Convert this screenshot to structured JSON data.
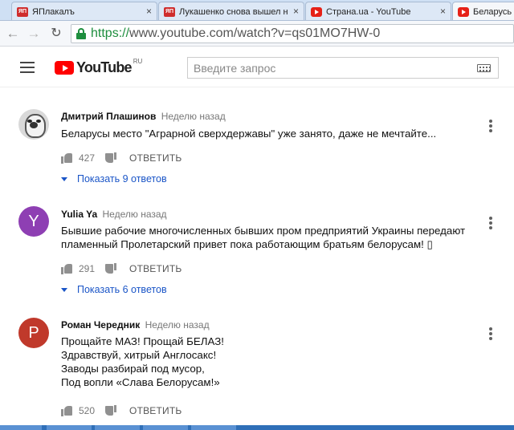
{
  "browser": {
    "tabs": [
      {
        "label": "ЯПлакалъ",
        "favicon": "yaplakal-favicon",
        "active": false
      },
      {
        "label": "Лукашенко снова вышел н",
        "favicon": "yaplakal-favicon",
        "active": false
      },
      {
        "label": "Страна.ua - YouTube",
        "favicon": "youtube-favicon",
        "active": false
      },
      {
        "label": "Беларусь в",
        "favicon": "youtube-favicon",
        "active": true
      }
    ],
    "close_glyph": "×",
    "url_scheme": "https://",
    "url_rest": "www.youtube.com/watch?v=qs01MO7HW-0"
  },
  "youtube": {
    "logo_text": "YouTube",
    "region": "RU",
    "search_placeholder": "Введите запрос"
  },
  "comments": [
    {
      "author": "Дмитрий Плашинов",
      "time": "Неделю назад",
      "avatar_letter": "",
      "avatar_kind": "dog-picture",
      "lines": [
        "Беларусы место \"Аграрной сверхдержавы\" уже занято, даже не мечтайте..."
      ],
      "likes": "427",
      "reply_label": "ОТВЕТИТЬ",
      "show_replies": "Показать 9 ответов"
    },
    {
      "author": "Yulia Ya",
      "time": "Неделю назад",
      "avatar_letter": "Y",
      "avatar_color": "#8e3fb3",
      "lines": [
        "Бывшие рабочие многочисленных бывших пром предприятий Украины передают",
        "пламенный Пролетарский привет пока работающим братьям белорусам! ▯"
      ],
      "likes": "291",
      "reply_label": "ОТВЕТИТЬ",
      "show_replies": "Показать 6 ответов"
    },
    {
      "author": "Роман Чередник",
      "time": "Неделю назад",
      "avatar_letter": "P",
      "avatar_color": "#c0392b",
      "lines": [
        "Прощайте МАЗ! Прощай БЕЛАЗ!",
        "Здравствуй, хитрый Англосакс!",
        "Заводы разбирай под мусор,",
        "Под вопли «Слава Белорусам!»"
      ],
      "likes": "520",
      "reply_label": "ОТВЕТИТЬ"
    }
  ]
}
